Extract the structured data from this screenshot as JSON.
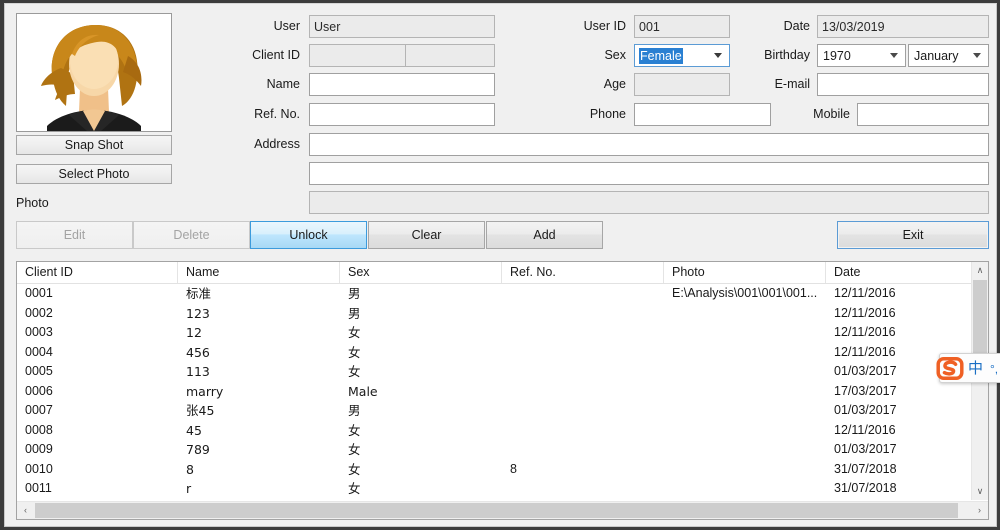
{
  "form": {
    "left_labels": {
      "user": "User",
      "client_id": "Client ID",
      "name": "Name",
      "ref_no": "Ref. No.",
      "address": "Address",
      "photo": "Photo"
    },
    "right_labels": {
      "user_id": "User ID",
      "sex": "Sex",
      "age": "Age",
      "phone": "Phone",
      "date": "Date",
      "birthday": "Birthday",
      "email": "E-mail",
      "mobile": "Mobile"
    },
    "values": {
      "user": "User",
      "client_id_a": "",
      "client_id_b": "",
      "name": "",
      "ref_no": "",
      "address_line1": "",
      "address_line2": "",
      "photo_path": "",
      "user_id": "001",
      "sex": "Female",
      "age": "",
      "phone": "",
      "date": "13/03/2019",
      "birthday_year": "1970",
      "birthday_month": "January",
      "email": "",
      "mobile": ""
    }
  },
  "photo_buttons": {
    "snap_shot": "Snap Shot",
    "select_photo": "Select Photo"
  },
  "actions": {
    "edit": "Edit",
    "delete": "Delete",
    "unlock": "Unlock",
    "clear": "Clear",
    "add": "Add",
    "exit": "Exit"
  },
  "table": {
    "columns": [
      "Client ID",
      "Name",
      "Sex",
      "Ref. No.",
      "Photo",
      "Date"
    ],
    "rows": [
      {
        "client_id": "0001",
        "name": "标准",
        "sex": "男",
        "ref_no": "",
        "photo": "E:\\Analysis\\001\\001\\001...",
        "date": "12/11/2016"
      },
      {
        "client_id": "0002",
        "name": "123",
        "sex": "男",
        "ref_no": "",
        "photo": "",
        "date": "12/11/2016"
      },
      {
        "client_id": "0003",
        "name": "12",
        "sex": "女",
        "ref_no": "",
        "photo": "",
        "date": "12/11/2016"
      },
      {
        "client_id": "0004",
        "name": "456",
        "sex": "女",
        "ref_no": "",
        "photo": "",
        "date": "12/11/2016"
      },
      {
        "client_id": "0005",
        "name": "113",
        "sex": "女",
        "ref_no": "",
        "photo": "",
        "date": "01/03/2017"
      },
      {
        "client_id": "0006",
        "name": "marry",
        "sex": "Male",
        "ref_no": "",
        "photo": "",
        "date": "17/03/2017"
      },
      {
        "client_id": "0007",
        "name": "张45",
        "sex": "男",
        "ref_no": "",
        "photo": "",
        "date": "01/03/2017"
      },
      {
        "client_id": "0008",
        "name": "45",
        "sex": "女",
        "ref_no": "",
        "photo": "",
        "date": "12/11/2016"
      },
      {
        "client_id": "0009",
        "name": "789",
        "sex": "女",
        "ref_no": "",
        "photo": "",
        "date": "01/03/2017"
      },
      {
        "client_id": "0010",
        "name": "8",
        "sex": "女",
        "ref_no": "8",
        "photo": "",
        "date": "31/07/2018"
      },
      {
        "client_id": "0011",
        "name": "r",
        "sex": "女",
        "ref_no": "",
        "photo": "",
        "date": "31/07/2018"
      }
    ]
  },
  "scrollbars": {
    "up_arrow": "∧",
    "down_arrow": "∨",
    "left_arrow": "‹",
    "right_arrow": "›"
  },
  "ime": {
    "logo": "S",
    "mode": "中",
    "punctuation": "°,"
  },
  "colors": {
    "window_bg": "#f0f0f0",
    "accent_focus": "#5b9bd5",
    "hot_button": "#bee6fd",
    "selection": "#2a80d2",
    "ime_blue": "#1a6fc4"
  }
}
